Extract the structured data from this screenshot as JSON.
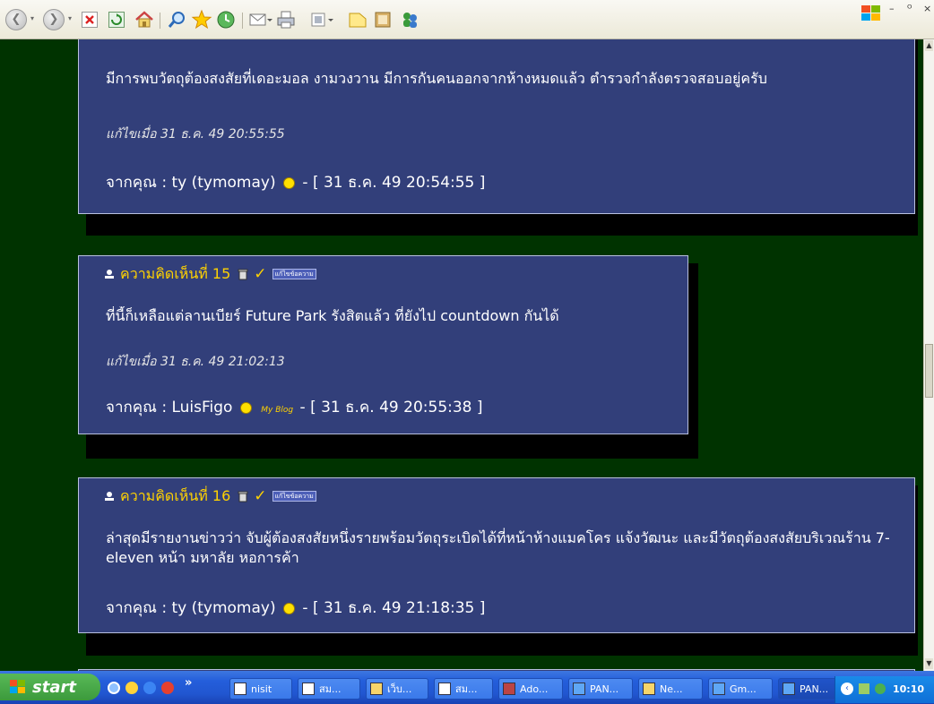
{
  "toolbar": {
    "buttons": [
      "back-icon",
      "forward-icon",
      "stop-icon",
      "refresh-icon",
      "home-icon",
      "search-icon",
      "favorites-icon",
      "history-icon",
      "mail-icon",
      "print-icon",
      "edit-icon",
      "discuss-icon",
      "research-icon",
      "messenger-icon"
    ],
    "window_controls": {
      "minimize": "–",
      "restore": "ᴼ",
      "close": "×"
    }
  },
  "posts": [
    {
      "body": "มีการพบวัตถุต้องสงสัยที่เดอะมอล งามวงวาน มีการกันคนออกจากห้างหมดแล้ว ตำรวจกำลังตรวจสอบอยู่ครับ",
      "edited": "แก้ไขเมื่อ 31 ธ.ค. 49 20:55:55",
      "from_prefix": "จากคุณ : ty (tymomay)",
      "from_suffix": " - [ 31 ธ.ค. 49 20:54:55 ]"
    },
    {
      "title": "ความคิดเห็นที่ 15",
      "edit_badge": "แก้ไขข้อความ",
      "body": "ที่นี้ก็เหลือแต่ลานเบียร์ Future Park รังสิตแล้ว ที่ยังไป countdown กันได้",
      "edited": "แก้ไขเมื่อ 31 ธ.ค. 49 21:02:13",
      "from_prefix": "จากคุณ : LuisFigo",
      "blog": "My Blog",
      "from_suffix": " - [ 31 ธ.ค. 49 20:55:38 ]"
    },
    {
      "title": "ความคิดเห็นที่ 16",
      "edit_badge": "แก้ไขข้อความ",
      "body": "ล่าสุดมีรายงานข่าวว่า จับผู้ต้องสงสัยหนึ่งรายพร้อมวัตถุระเบิดได้ที่หน้าห้างแมคโคร แจ้งวัฒนะ และมีวัตถุต้องสงสัยบริเวณร้าน 7-eleven หน้า มหาลัย หอการค้า",
      "from_prefix": "จากคุณ : ty (tymomay)",
      "from_suffix": " - [ 31 ธ.ค. 49 21:18:35 ]"
    }
  ],
  "taskbar": {
    "start_label": "start",
    "chevron": "»",
    "tasks": [
      {
        "label": "nisit"
      },
      {
        "label": "สม..."
      },
      {
        "label": "เว็บ..."
      },
      {
        "label": "สม..."
      },
      {
        "label": "Ado..."
      },
      {
        "label": "PAN..."
      },
      {
        "label": "Ne..."
      },
      {
        "label": "Gm..."
      },
      {
        "label": "PAN..."
      }
    ],
    "clock": "10:10"
  },
  "colors": {
    "page_bg": "#003300",
    "card_bg": "#323f7a",
    "title_yellow": "#ffd200",
    "taskbar_blue": "#245edb"
  }
}
